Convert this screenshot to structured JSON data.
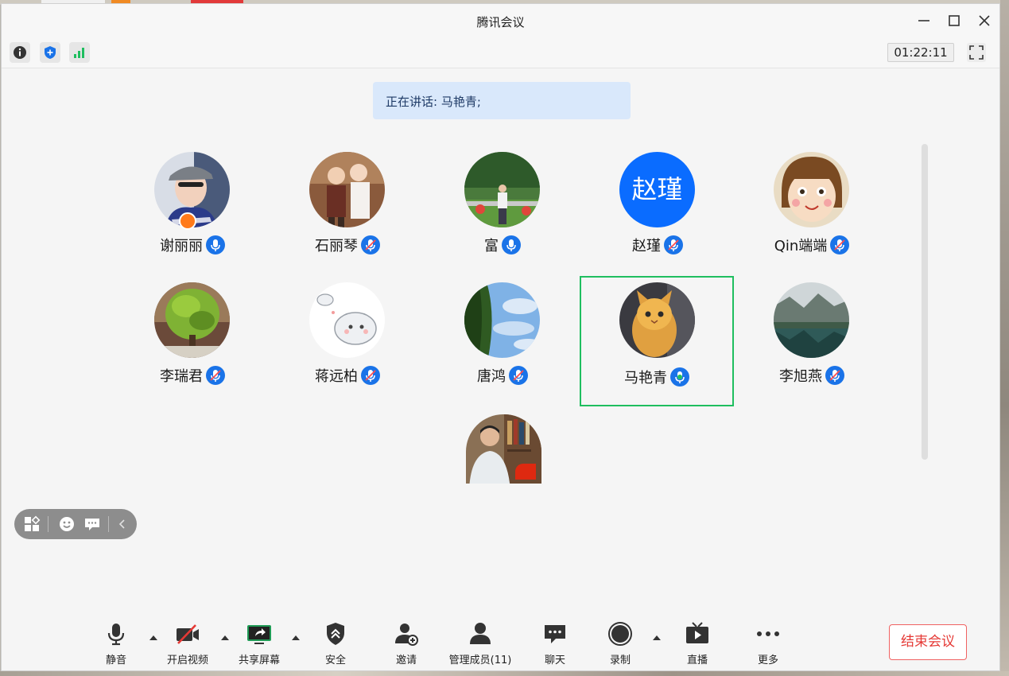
{
  "window": {
    "title": "腾讯会议"
  },
  "infobar": {
    "timer": "01:22:11"
  },
  "speaking": {
    "text": "正在讲话: 马艳青;"
  },
  "participants": [
    {
      "name": "谢丽丽",
      "mic": "on",
      "avatar": "photo-woman-hat",
      "host": true
    },
    {
      "name": "石丽琴",
      "mic": "muted",
      "avatar": "photo-children"
    },
    {
      "name": "富",
      "mic": "on",
      "avatar": "photo-man-park"
    },
    {
      "name": "赵瑾",
      "mic": "muted",
      "avatar_text": "赵瑾"
    },
    {
      "name": "Qin端端",
      "mic": "muted",
      "avatar": "cartoon-girl"
    },
    {
      "name": "李瑞君",
      "mic": "muted",
      "avatar": "photo-tree"
    },
    {
      "name": "蒋远柏",
      "mic": "muted",
      "avatar": "cartoon-cat"
    },
    {
      "name": "唐鸿",
      "mic": "muted",
      "avatar": "photo-sky"
    },
    {
      "name": "马艳青",
      "mic": "speaking",
      "avatar": "photo-kitten",
      "active": true
    },
    {
      "name": "李旭燕",
      "mic": "muted",
      "avatar": "photo-lake"
    },
    {
      "name": "",
      "mic": "none",
      "avatar": "photo-man-books",
      "flag": "china-flag"
    }
  ],
  "toolbar": {
    "mute": "静音",
    "video": "开启视频",
    "share": "共享屏幕",
    "security": "安全",
    "invite": "邀请",
    "members": "管理成员(11)",
    "chat": "聊天",
    "record": "录制",
    "live": "直播",
    "more": "更多",
    "end": "结束会议"
  },
  "colors": {
    "accent": "#1a73e8",
    "speaking": "#1fbe5f",
    "end": "#e53935",
    "banner": "#d9e8fb"
  }
}
